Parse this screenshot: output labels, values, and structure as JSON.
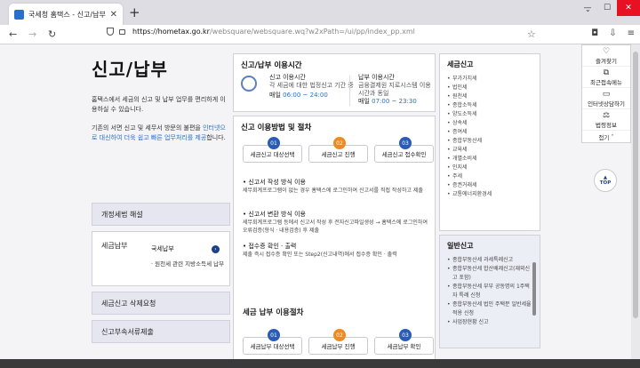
{
  "browser": {
    "tab_title": "국세청 홈택스 - 신고/납부",
    "url_host": "https://hometax.go.kr",
    "url_path": "/websquare/websquare.wq?w2xPath=/ui/pp/index_pp.xml"
  },
  "page": {
    "title": "신고/납부",
    "intro": "홈택스에서 세금의 신고 및 납부 업무를 편리하게 이용하실 수 있습니다.",
    "intro2_a": "기존의 서면 신고 및 세무서 방문의 불편을 ",
    "intro2_b": "인터넷으로 대신하여 더욱 쉽고 빠른 업무처리를 제공",
    "intro2_c": "합니다."
  },
  "side_menu": {
    "reform": "개정세법 해설",
    "tax_payment": "세금납부",
    "sub_national": "국세납부",
    "sub_local": "· 원천세 관련 지방소득세 납부",
    "delete_req": "세금신고 삭제요청",
    "attach": "신고부속서류제출"
  },
  "hours": {
    "title": "신고/납부 이용시간",
    "report_label": "신고 이용시간",
    "report_sub": "각 세금에 대한 법정신고 기간 중",
    "report_hours_prefix": "매일",
    "report_hours": "06:00 ~ 24:00",
    "pay_label": "납부 이용시간",
    "pay_sub": "금융결제원 지로시스템 이용시간과 동일",
    "pay_hours_prefix": "매일",
    "pay_hours": "07:00 ~ 23:30"
  },
  "method": {
    "title": "신고 이용방법 및 절차",
    "steps": [
      {
        "num": "01",
        "label": "세금신고 대상선택"
      },
      {
        "num": "02",
        "label": "세금신고 진행"
      },
      {
        "num": "03",
        "label": "세금신고 접수확인"
      }
    ],
    "note1_h": "• 신고서 작성 방식 이용",
    "note1": "세무회계프로그램이 없는 경우 홈택스에 로그인하여 신고서를 직접 작성하고 제출",
    "note2_h": "• 신고서 변환 방식 이용",
    "note2": "세무회계프로그램 등에서 신고서 작성 후 전자신고파일생성 → 홈택스에 로그인하여 오류검증(형식 · 내용검증) 후 제출",
    "note3_h": "• 접수증 확인 · 출력",
    "note3": "제출 즉시 접수증 확인 또는 Step2(신고내역)에서 접수증 확인 · 출력"
  },
  "pay_proc": {
    "title": "세금 납부 이용절차",
    "steps": [
      {
        "num": "01",
        "label": "세금납부 대상선택"
      },
      {
        "num": "02",
        "label": "세금납부 진행"
      },
      {
        "num": "03",
        "label": "세금납부 확인"
      }
    ]
  },
  "tax_report": {
    "title": "세금신고",
    "items": [
      "부가가치세",
      "법인세",
      "원천세",
      "종합소득세",
      "양도소득세",
      "상속세",
      "증여세",
      "종합부동산세",
      "교육세",
      "개별소비세",
      "인지세",
      "주세",
      "증권거래세",
      "교통에너지환경세"
    ]
  },
  "general": {
    "title": "일반신고",
    "items": [
      "종합부동산세 과세특례신고",
      "종합부동산세 합산배제신고(재외신고 포함)",
      "종합부동산세 부부 공동명의 1주택자 특례 신청",
      "종합부동산세 법인 주택분 일반세율 적용 신청",
      "사업장현황 신고"
    ]
  },
  "util": {
    "fav": "즐겨찾기",
    "recent": "최근접속메뉴",
    "consult": "인터넷상담하기",
    "law": "법령정보",
    "fold": "접기",
    "top": "TOP"
  }
}
